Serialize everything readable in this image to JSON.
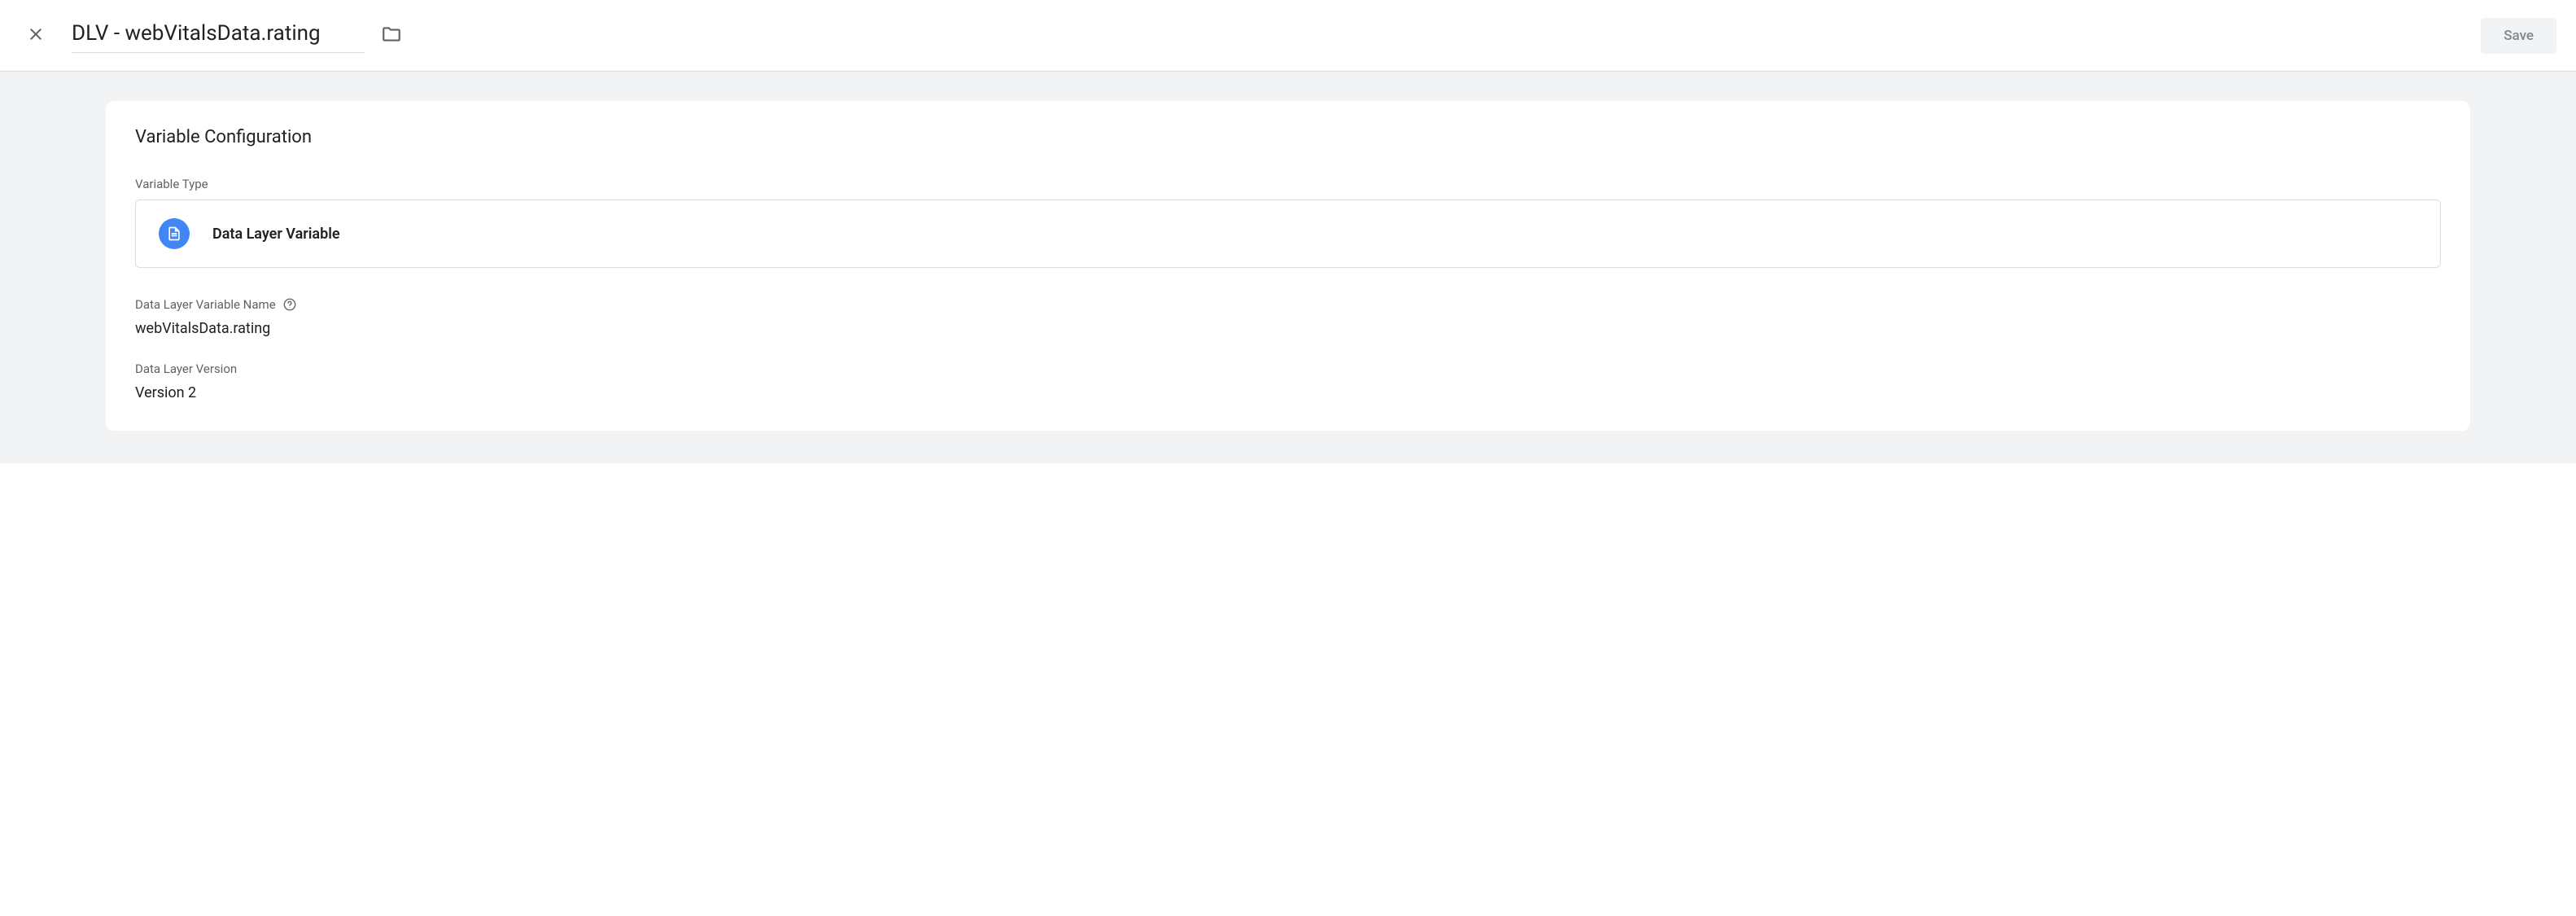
{
  "header": {
    "title": "DLV - webVitalsData.rating",
    "save_label": "Save"
  },
  "card": {
    "title": "Variable Configuration",
    "variable_type_label": "Variable Type",
    "variable_type_value": "Data Layer Variable",
    "variable_name_label": "Data Layer Variable Name",
    "variable_name_value": "webVitalsData.rating",
    "version_label": "Data Layer Version",
    "version_value": "Version 2"
  }
}
